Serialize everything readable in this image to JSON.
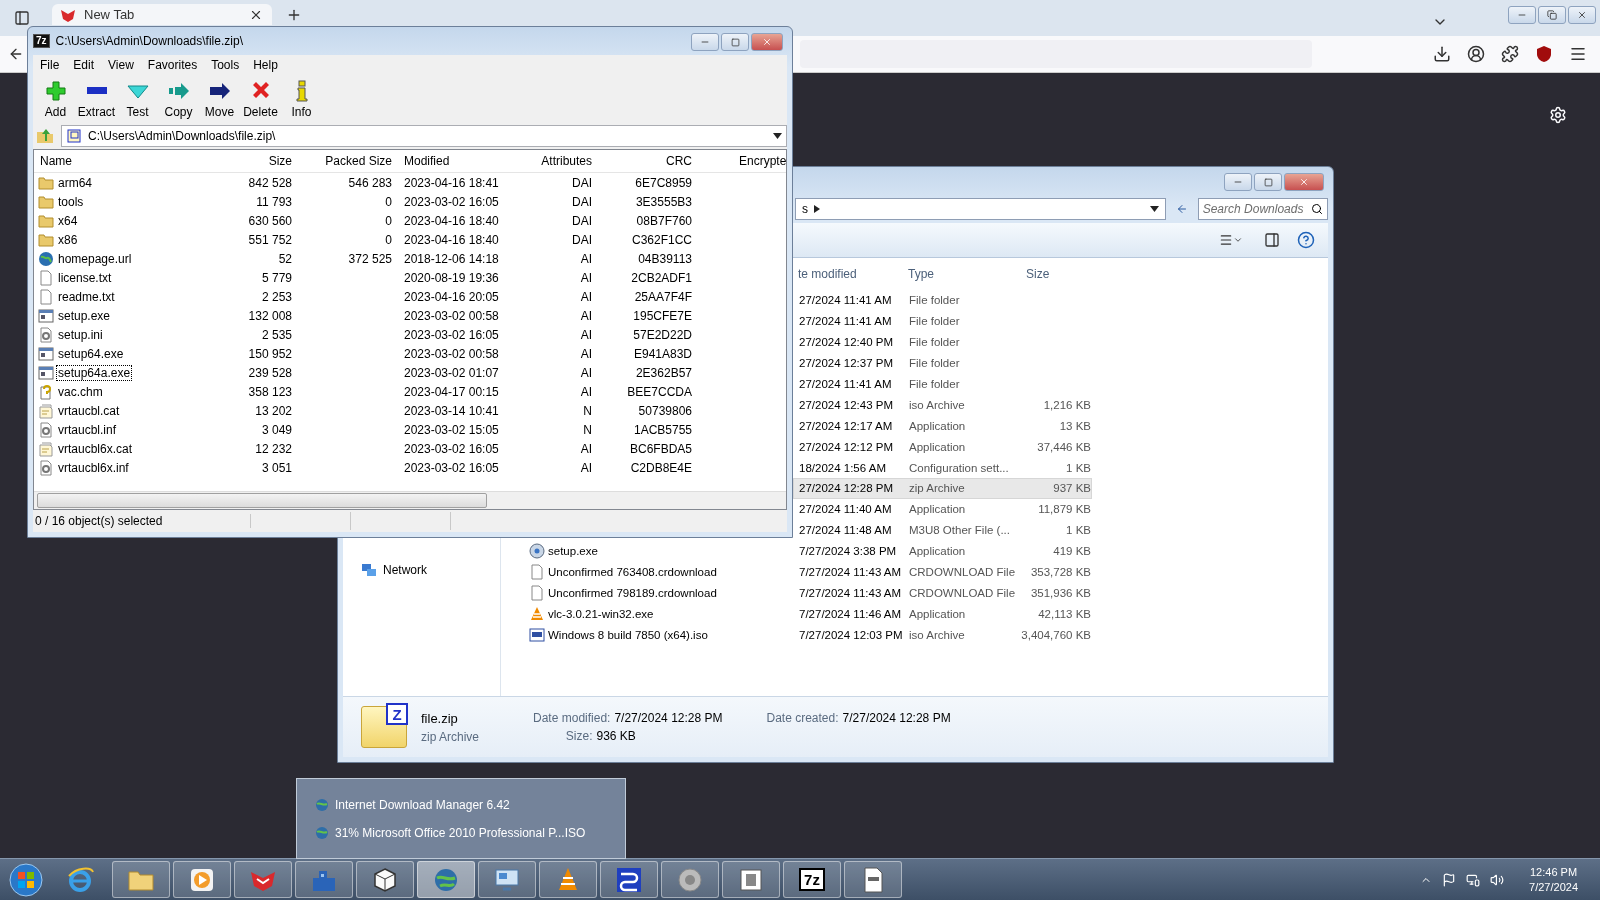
{
  "browser": {
    "tab": {
      "title": "New Tab"
    }
  },
  "archive_window": {
    "title": "C:\\Users\\Admin\\Downloads\\file.zip\\",
    "title_icon": "7z",
    "menu": [
      "File",
      "Edit",
      "View",
      "Favorites",
      "Tools",
      "Help"
    ],
    "toolbar": [
      {
        "label": "Add",
        "kind": "add"
      },
      {
        "label": "Extract",
        "kind": "extract"
      },
      {
        "label": "Test",
        "kind": "test"
      },
      {
        "label": "Copy",
        "kind": "copy"
      },
      {
        "label": "Move",
        "kind": "move"
      },
      {
        "label": "Delete",
        "kind": "delete"
      },
      {
        "label": "Info",
        "kind": "info"
      }
    ],
    "path": "C:\\Users\\Admin\\Downloads\\file.zip\\",
    "columns": [
      "Name",
      "Size",
      "Packed Size",
      "Modified",
      "Attributes",
      "CRC",
      "Encrypte"
    ],
    "rows": [
      {
        "name": "arm64",
        "kind": "folder",
        "size": "842 528",
        "packed": "546 283",
        "modified": "2023-04-16 18:41",
        "attributes": "DAI",
        "crc": "6E7C8959",
        "focused": false
      },
      {
        "name": "tools",
        "kind": "folder",
        "size": "11 793",
        "packed": "0",
        "modified": "2023-03-02 16:05",
        "attributes": "DAI",
        "crc": "3E3555B3",
        "focused": false
      },
      {
        "name": "x64",
        "kind": "folder",
        "size": "630 560",
        "packed": "0",
        "modified": "2023-04-16 18:40",
        "attributes": "DAI",
        "crc": "08B7F760",
        "focused": false
      },
      {
        "name": "x86",
        "kind": "folder",
        "size": "551 752",
        "packed": "0",
        "modified": "2023-04-16 18:40",
        "attributes": "DAI",
        "crc": "C362F1CC",
        "focused": false
      },
      {
        "name": "homepage.url",
        "kind": "url",
        "size": "52",
        "packed": "372 525",
        "modified": "2018-12-06 14:18",
        "attributes": "AI",
        "crc": "04B39113",
        "focused": false
      },
      {
        "name": "license.txt",
        "kind": "text",
        "size": "5 779",
        "modified": "2020-08-19 19:36",
        "attributes": "AI",
        "crc": "2CB2ADF1",
        "focused": false
      },
      {
        "name": "readme.txt",
        "kind": "text",
        "size": "2 253",
        "modified": "2023-04-16 20:05",
        "attributes": "AI",
        "crc": "25AA7F4F",
        "focused": false
      },
      {
        "name": "setup.exe",
        "kind": "exe",
        "size": "132 008",
        "modified": "2023-03-02 00:58",
        "attributes": "AI",
        "crc": "195CFE7E",
        "focused": false
      },
      {
        "name": "setup.ini",
        "kind": "settings",
        "size": "2 535",
        "modified": "2023-03-02 16:05",
        "attributes": "AI",
        "crc": "57E2D22D",
        "focused": false
      },
      {
        "name": "setup64.exe",
        "kind": "exe",
        "size": "150 952",
        "modified": "2023-03-02 00:58",
        "attributes": "AI",
        "crc": "E941A83D",
        "focused": false
      },
      {
        "name": "setup64a.exe",
        "kind": "exe",
        "size": "239 528",
        "modified": "2023-03-02 01:07",
        "attributes": "AI",
        "crc": "2E362B57",
        "focused": true
      },
      {
        "name": "vac.chm",
        "kind": "help",
        "size": "358 123",
        "modified": "2023-04-17 00:15",
        "attributes": "AI",
        "crc": "BEE7CCDA",
        "focused": false
      },
      {
        "name": "vrtaucbl.cat",
        "kind": "catalog",
        "size": "13 202",
        "modified": "2023-03-14 10:41",
        "attributes": "N",
        "crc": "50739806",
        "focused": false
      },
      {
        "name": "vrtaucbl.inf",
        "kind": "settings",
        "size": "3 049",
        "modified": "2023-03-02 15:05",
        "attributes": "N",
        "crc": "1ACB5755",
        "focused": false
      },
      {
        "name": "vrtaucbl6x.cat",
        "kind": "catalog",
        "size": "12 232",
        "modified": "2023-03-02 16:05",
        "attributes": "AI",
        "crc": "BC6FBDA5",
        "focused": false
      },
      {
        "name": "vrtaucbl6x.inf",
        "kind": "settings",
        "size": "3 051",
        "modified": "2023-03-02 16:05",
        "attributes": "AI",
        "crc": "C2DB8E4E",
        "focused": false
      }
    ],
    "status": "0 / 16 object(s) selected"
  },
  "explorer": {
    "breadcrumb": "s",
    "search_placeholder": "Search Downloads",
    "nav": [
      {
        "label": "Network"
      }
    ],
    "columns": [
      "te modified",
      "Type",
      "Size"
    ],
    "rows": [
      {
        "modified": "27/2024 11:41 AM",
        "type": "File folder",
        "selected": false
      },
      {
        "modified": "27/2024 11:41 AM",
        "type": "File folder",
        "selected": false
      },
      {
        "modified": "27/2024 12:40 PM",
        "type": "File folder",
        "selected": false
      },
      {
        "modified": "27/2024 12:37 PM",
        "type": "File folder",
        "selected": false
      },
      {
        "modified": "27/2024 11:41 AM",
        "type": "File folder",
        "selected": false
      },
      {
        "modified": "27/2024 12:43 PM",
        "type": "iso Archive",
        "size": "1,216 KB",
        "selected": false
      },
      {
        "modified": "27/2024 12:17 AM",
        "type": "Application",
        "size": "13 KB",
        "selected": false
      },
      {
        "modified": "27/2024 12:12 PM",
        "type": "Application",
        "size": "37,446 KB",
        "selected": false
      },
      {
        "modified": "18/2024 1:56 AM",
        "type": "Configuration sett...",
        "size": "1 KB",
        "selected": false
      },
      {
        "modified": "27/2024 12:28 PM",
        "type": "zip Archive",
        "size": "937 KB",
        "selected": true
      },
      {
        "modified": "27/2024 11:40 AM",
        "type": "Application",
        "size": "11,879 KB",
        "selected": false
      },
      {
        "modified": "27/2024 11:48 AM",
        "type": "M3U8 Other File (...",
        "size": "1 KB",
        "selected": false
      },
      {
        "name": "setup.exe",
        "kind": "setup",
        "modified": "7/27/2024 3:38 PM",
        "type": "Application",
        "size": "419 KB",
        "selected": false
      },
      {
        "name": "Unconfirmed 763408.crdownload",
        "kind": "file",
        "modified": "7/27/2024 11:43 AM",
        "type": "CRDOWNLOAD File",
        "size": "353,728 KB",
        "selected": false
      },
      {
        "name": "Unconfirmed 798189.crdownload",
        "kind": "file",
        "modified": "7/27/2024 11:43 AM",
        "type": "CRDOWNLOAD File",
        "size": "351,936 KB",
        "selected": false
      },
      {
        "name": "vlc-3.0.21-win32.exe",
        "kind": "vlc",
        "modified": "7/27/2024 11:46 AM",
        "type": "Application",
        "size": "42,113 KB",
        "selected": false
      },
      {
        "name": "Windows 8 build 7850 (x64).iso",
        "kind": "iso",
        "modified": "7/27/2024 12:03 PM",
        "type": "iso Archive",
        "size": "3,404,760 KB",
        "selected": false
      }
    ],
    "details": {
      "icon_letter": "Z",
      "name": "file.zip",
      "type": "zip Archive",
      "modified_label": "Date modified:",
      "modified": "7/27/2024 12:28 PM",
      "size_label": "Size:",
      "size": "936 KB",
      "created_label": "Date created:",
      "created": "7/27/2024 12:28 PM"
    }
  },
  "downloads_popup": {
    "items": [
      "Internet Download Manager 6.42",
      "31% Microsoft Office 2010 Professional P...ISO"
    ]
  },
  "taskbar": {
    "items": [
      {
        "kind": "ie",
        "running": false,
        "selected": false
      },
      {
        "kind": "folder",
        "running": true,
        "selected": false
      },
      {
        "kind": "media",
        "running": true,
        "selected": false
      },
      {
        "kind": "fox",
        "running": true,
        "selected": false
      },
      {
        "kind": "buildings",
        "running": true,
        "selected": false
      },
      {
        "kind": "cube",
        "running": true,
        "selected": false
      },
      {
        "kind": "globe",
        "running": true,
        "selected": true
      },
      {
        "kind": "monitor",
        "running": true,
        "selected": false
      },
      {
        "kind": "vlc",
        "running": true,
        "selected": false
      },
      {
        "kind": "network",
        "running": true,
        "selected": false
      },
      {
        "kind": "speaker",
        "running": true,
        "selected": false
      },
      {
        "kind": "window",
        "running": true,
        "selected": false
      },
      {
        "kind": "sevenzip",
        "label": "7z",
        "running": true,
        "selected": false
      },
      {
        "kind": "document",
        "running": true,
        "selected": false
      }
    ],
    "clock": {
      "time": "12:46 PM",
      "date": "7/27/2024"
    }
  }
}
